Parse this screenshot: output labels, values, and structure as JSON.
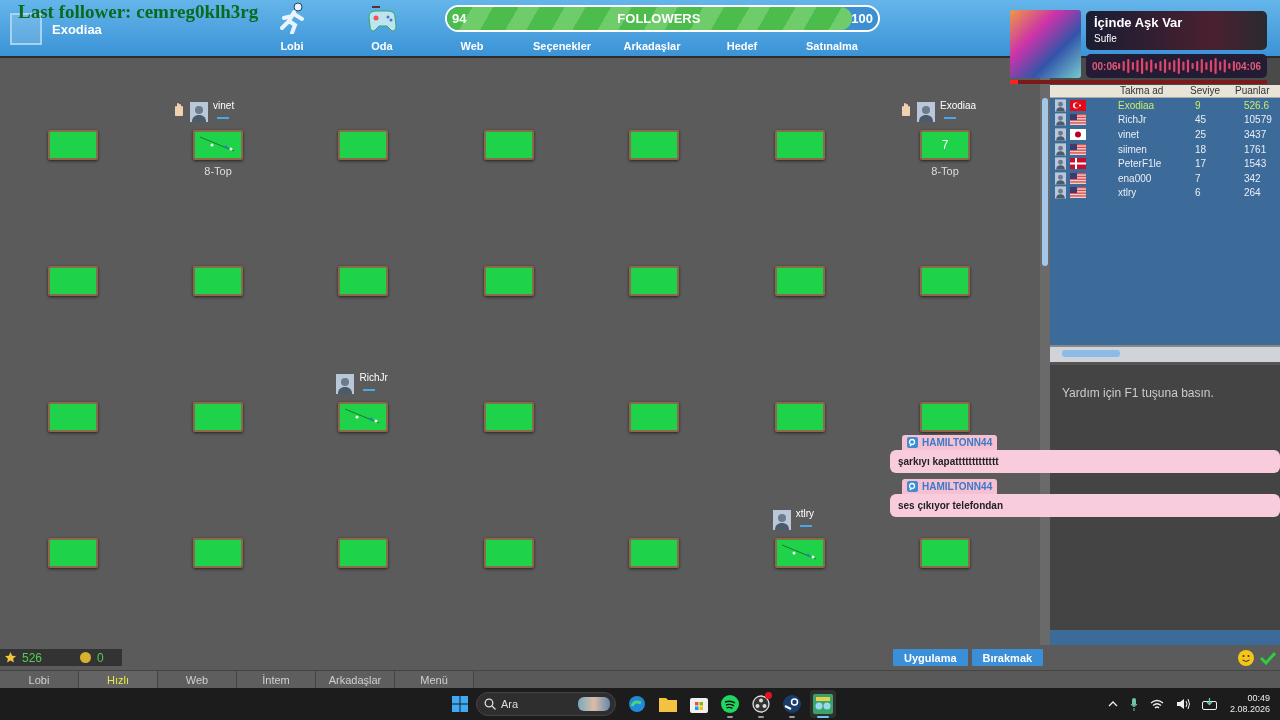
{
  "overlay": {
    "last_follower": "Last follower: cemreg0klh3rg"
  },
  "profile": {
    "name": "Exodiaa"
  },
  "nav": [
    {
      "label": "Lobi"
    },
    {
      "label": "Oda"
    },
    {
      "label": "Web"
    },
    {
      "label": "Seçenekler"
    },
    {
      "label": "Arkadaşlar"
    },
    {
      "label": "Hedef"
    },
    {
      "label": "Satınalma"
    }
  ],
  "followers_goal": {
    "current": "94",
    "title": "FOLLOWERS",
    "target": "100",
    "level": 0.94
  },
  "now_playing": {
    "title": "İçinde Aşk Var",
    "artist": "Sufle",
    "elapsed": "00:06",
    "duration": "04:06",
    "level": 0.03
  },
  "table_rows": [
    [
      {
        "in_play": false
      },
      {
        "in_play": true,
        "player": {
          "name": "vinet",
          "hand_raised": true
        },
        "game": "8-Top"
      },
      {
        "in_play": false
      },
      {
        "in_play": false
      },
      {
        "in_play": false
      },
      {
        "in_play": false
      },
      {
        "in_play": false,
        "player": {
          "name": "Exodiaa",
          "hand_raised": true
        },
        "game": "8-Top",
        "number": "7"
      }
    ],
    [
      {
        "in_play": false
      },
      {
        "in_play": false
      },
      {
        "in_play": false
      },
      {
        "in_play": false
      },
      {
        "in_play": false
      },
      {
        "in_play": false
      },
      {
        "in_play": false
      }
    ],
    [
      {
        "in_play": false
      },
      {
        "in_play": false
      },
      {
        "in_play": true,
        "player": {
          "name": "RichJr",
          "hand_raised": false
        }
      },
      {
        "in_play": false
      },
      {
        "in_play": false
      },
      {
        "in_play": false
      },
      {
        "in_play": false
      }
    ],
    [
      {
        "in_play": false
      },
      {
        "in_play": false
      },
      {
        "in_play": false
      },
      {
        "in_play": false
      },
      {
        "in_play": false
      },
      {
        "in_play": true,
        "player": {
          "name": "xtlry",
          "hand_raised": false
        }
      },
      {
        "in_play": false
      }
    ]
  ],
  "player_list": {
    "columns": [
      "Takma ad",
      "Seviye",
      "Puanlar"
    ],
    "rows": [
      {
        "name": "Exodiaa",
        "rank": "9",
        "points": "526.6",
        "kind": "tr",
        "selected": true
      },
      {
        "name": "RichJr",
        "rank": "45",
        "points": "10579",
        "kind": "us",
        "selected": false
      },
      {
        "name": "vinet",
        "rank": "25",
        "points": "3437",
        "kind": "jp",
        "selected": false
      },
      {
        "name": "siimen",
        "rank": "18",
        "points": "1761",
        "kind": "us",
        "selected": false
      },
      {
        "name": "PeterF1le",
        "rank": "17",
        "points": "1543",
        "kind": "dk",
        "selected": false
      },
      {
        "name": "ena000",
        "rank": "7",
        "points": "342",
        "kind": "us",
        "selected": false
      },
      {
        "name": "xtlry",
        "rank": "6",
        "points": "264",
        "kind": "us",
        "selected": false
      }
    ]
  },
  "help_text": "Yardım için F1 tuşuna basın.",
  "chat_messages": [
    {
      "user": "HAMILTONN44",
      "text": "şarkıyı kapattttttttttttt"
    },
    {
      "user": "HAMILTONN44",
      "text": "ses çıkıyor telefondan"
    }
  ],
  "stats": {
    "score": "526",
    "coins": "0"
  },
  "buttons": [
    "Uygulama",
    "Bırakmak"
  ],
  "bottom_tabs": [
    {
      "label": "Lobi",
      "selected": false
    },
    {
      "label": "Hızlı",
      "selected": true
    },
    {
      "label": "Web",
      "selected": false
    },
    {
      "label": "İntem",
      "selected": false
    },
    {
      "label": "Arkadaşlar",
      "selected": false
    },
    {
      "label": "Menü",
      "selected": false
    }
  ],
  "taskbar": {
    "placeholder": "Ara",
    "apps": [
      {
        "kind": "edge",
        "running": false,
        "notification": false
      },
      {
        "kind": "folder",
        "running": false,
        "notification": false
      },
      {
        "kind": "store",
        "running": false,
        "notification": false
      },
      {
        "kind": "spotify",
        "running": true,
        "notification": false
      },
      {
        "kind": "obs",
        "running": true,
        "notification": true
      },
      {
        "kind": "steam",
        "running": true,
        "notification": false
      },
      {
        "kind": "game",
        "running": true,
        "active": true,
        "notification": false
      }
    ],
    "time": "00:49",
    "date": "2.08.2026"
  }
}
